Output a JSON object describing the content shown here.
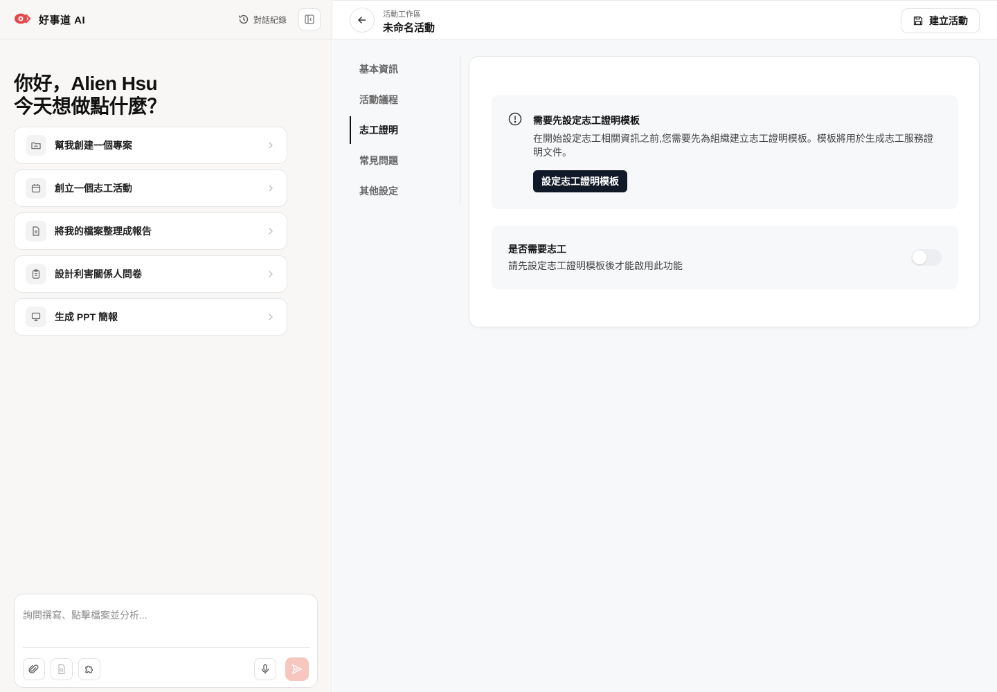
{
  "app": {
    "brand": "好事道 AI",
    "history_label": "對話紀錄"
  },
  "greeting": {
    "line1": "你好，Alien Hsu",
    "line2": "今天想做點什麼？"
  },
  "suggestions": [
    {
      "label": "幫我創建一個專案",
      "icon": "folder-chart-icon"
    },
    {
      "label": "創立一個志工活動",
      "icon": "calendar-icon"
    },
    {
      "label": "將我的檔案整理成報告",
      "icon": "document-icon"
    },
    {
      "label": "設計利害關係人問卷",
      "icon": "clipboard-icon"
    },
    {
      "label": "生成 PPT 簡報",
      "icon": "presentation-icon"
    }
  ],
  "composer": {
    "placeholder": "詢問撰寫、點擊檔案並分析..."
  },
  "workspace": {
    "breadcrumb_sub": "活動工作區",
    "title": "未命名活動",
    "create_label": "建立活動"
  },
  "nav": {
    "items": [
      "基本資訊",
      "活動議程",
      "志工證明",
      "常見問題",
      "其他設定"
    ],
    "active": "志工證明"
  },
  "notice": {
    "title": "需要先設定志工證明模板",
    "description": "在開始設定志工相關資訊之前,您需要先為組織建立志工證明模板。模板將用於生成志工服務證明文件。",
    "button": "設定志工證明模板"
  },
  "volunteer_toggle": {
    "title": "是否需要志工",
    "description": "請先設定志工證明模板後才能啟用此功能",
    "enabled": false
  },
  "colors": {
    "accent": "#e5484d",
    "dark_button": "#111827",
    "send_disabled": "#f7c7bf"
  }
}
